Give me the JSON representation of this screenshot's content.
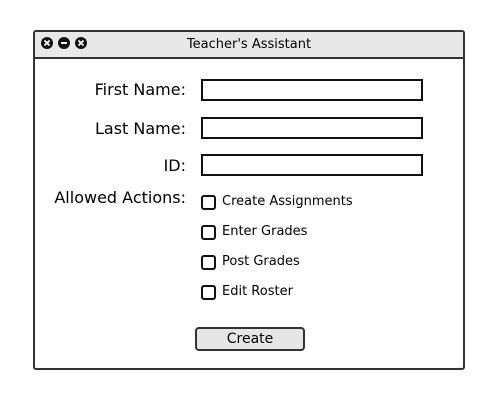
{
  "window": {
    "title": "Teacher's Assistant",
    "controls": [
      "close-icon",
      "minimize-icon",
      "maximize-icon"
    ]
  },
  "form": {
    "first_name": {
      "label": "First Name:",
      "value": ""
    },
    "last_name": {
      "label": "Last Name:",
      "value": ""
    },
    "id": {
      "label": "ID:",
      "value": ""
    },
    "allowed_actions": {
      "label": "Allowed Actions:",
      "options": [
        {
          "label": "Create Assignments",
          "checked": false
        },
        {
          "label": "Enter Grades",
          "checked": false
        },
        {
          "label": "Post Grades",
          "checked": false
        },
        {
          "label": "Edit Roster",
          "checked": false
        }
      ]
    },
    "create_label": "Create"
  },
  "colors": {
    "titlebar": "#e8e8e8",
    "border": "#333333",
    "button": "#e6e6e6"
  }
}
